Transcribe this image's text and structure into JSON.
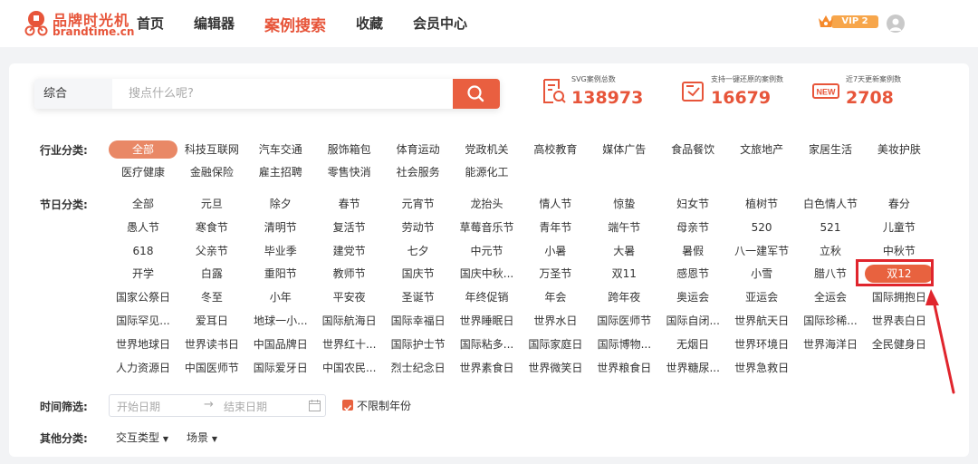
{
  "header": {
    "logo_cn": "品牌时光机",
    "logo_en": "brandtime.cn",
    "nav": [
      "首页",
      "编辑器",
      "案例搜索",
      "收藏",
      "会员中心"
    ],
    "active_nav": "案例搜索",
    "vip_label": "VIP 2"
  },
  "search": {
    "type": "综合",
    "placeholder": "搜点什么呢?"
  },
  "stats": [
    {
      "label": "SVG案例总数",
      "value": "138973",
      "icon": "search-document-icon"
    },
    {
      "label": "支持一键还原的案例数",
      "value": "16679",
      "icon": "restore-icon"
    },
    {
      "label": "近7天更新案例数",
      "value": "2708",
      "icon": "new-badge-icon"
    }
  ],
  "industry": {
    "label": "行业分类:",
    "items": [
      "全部",
      "科技互联网",
      "汽车交通",
      "服饰箱包",
      "体育运动",
      "党政机关",
      "高校教育",
      "媒体广告",
      "食品餐饮",
      "文旅地产",
      "家居生活",
      "美妆护肤",
      "医疗健康",
      "金融保险",
      "雇主招聘",
      "零售快消",
      "社会服务",
      "能源化工"
    ],
    "selected": "全部"
  },
  "festival": {
    "label": "节日分类:",
    "items": [
      "全部",
      "元旦",
      "除夕",
      "春节",
      "元宵节",
      "龙抬头",
      "情人节",
      "惊蛰",
      "妇女节",
      "植树节",
      "白色情人节",
      "春分",
      "愚人节",
      "寒食节",
      "清明节",
      "复活节",
      "劳动节",
      "草莓音乐节",
      "青年节",
      "端午节",
      "母亲节",
      "520",
      "521",
      "儿童节",
      "618",
      "父亲节",
      "毕业季",
      "建党节",
      "七夕",
      "中元节",
      "小暑",
      "大暑",
      "暑假",
      "八一建军节",
      "立秋",
      "中秋节",
      "开学",
      "白露",
      "重阳节",
      "教师节",
      "国庆节",
      "国庆中秋...",
      "万圣节",
      "双11",
      "感恩节",
      "小雪",
      "腊八节",
      "双12",
      "国家公祭日",
      "冬至",
      "小年",
      "平安夜",
      "圣诞节",
      "年终促销",
      "年会",
      "跨年夜",
      "奥运会",
      "亚运会",
      "全运会",
      "国际拥抱日",
      "国际罕见...",
      "爱耳日",
      "地球一小...",
      "国际航海日",
      "国际幸福日",
      "世界睡眠日",
      "世界水日",
      "国际医师节",
      "国际自闭...",
      "世界航天日",
      "国际珍稀...",
      "世界表白日",
      "世界地球日",
      "世界读书日",
      "中国品牌日",
      "世界红十...",
      "国际护士节",
      "国际粘多...",
      "国际家庭日",
      "国际博物...",
      "无烟日",
      "世界环境日",
      "世界海洋日",
      "全民健身日",
      "人力资源日",
      "中国医师节",
      "国际爱牙日",
      "中国农民...",
      "烈士纪念日",
      "世界素食日",
      "世界微笑日",
      "世界粮食日",
      "世界糖尿...",
      "世界急救日"
    ],
    "selected": "双12"
  },
  "time_filter": {
    "label": "时间筛选:",
    "start_placeholder": "开始日期",
    "separator": "→",
    "end_placeholder": "结束日期",
    "no_limit_label": "不限制年份",
    "no_limit_checked": true
  },
  "other": {
    "label": "其他分类:",
    "dropdowns": [
      "交互类型",
      "场景"
    ]
  },
  "colors": {
    "accent": "#e7553a",
    "highlight_border": "#e0252d"
  }
}
